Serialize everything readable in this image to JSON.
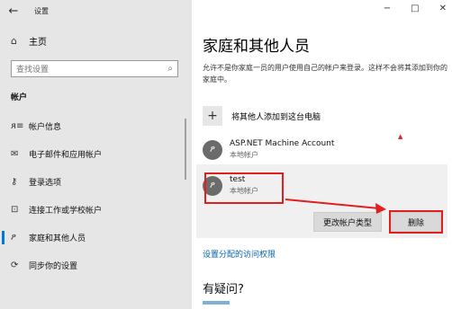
{
  "window": {
    "back_glyph": "←",
    "title": "设置",
    "minimize": "−",
    "maximize": "□",
    "close": "✕"
  },
  "sidebar": {
    "home_label": "主页",
    "search_placeholder": "查找设置",
    "section_title": "帐户",
    "items": [
      {
        "label": "帐户信息",
        "icon": "person-list-icon"
      },
      {
        "label": "电子邮件和应用帐户",
        "icon": "mail-icon"
      },
      {
        "label": "登录选项",
        "icon": "key-icon"
      },
      {
        "label": "连接工作或学校帐户",
        "icon": "briefcase-icon"
      },
      {
        "label": "家庭和其他人员",
        "icon": "person-icon",
        "active": true
      },
      {
        "label": "同步你的设置",
        "icon": "sync-icon"
      }
    ]
  },
  "main": {
    "title": "家庭和其他人员",
    "description": "允许不是你家庭一员的用户使用自己的帐户来登录。这样不会将其添加到你的家庭中。",
    "add_label": "将其他人添加到这台电脑",
    "accounts": [
      {
        "name": "ASP.NET Machine Account",
        "type": "本地帐户"
      },
      {
        "name": "test",
        "type": "本地帐户"
      }
    ],
    "change_type_button": "更改帐户类型",
    "delete_button": "删除",
    "assigned_access_link": "设置分配的访问权限",
    "faq_title": "有疑问?"
  },
  "colors": {
    "sidebar_bg": "#e6e6e6",
    "accent": "#0078d7",
    "annotation_red": "#e02020",
    "link": "#0063b1"
  }
}
